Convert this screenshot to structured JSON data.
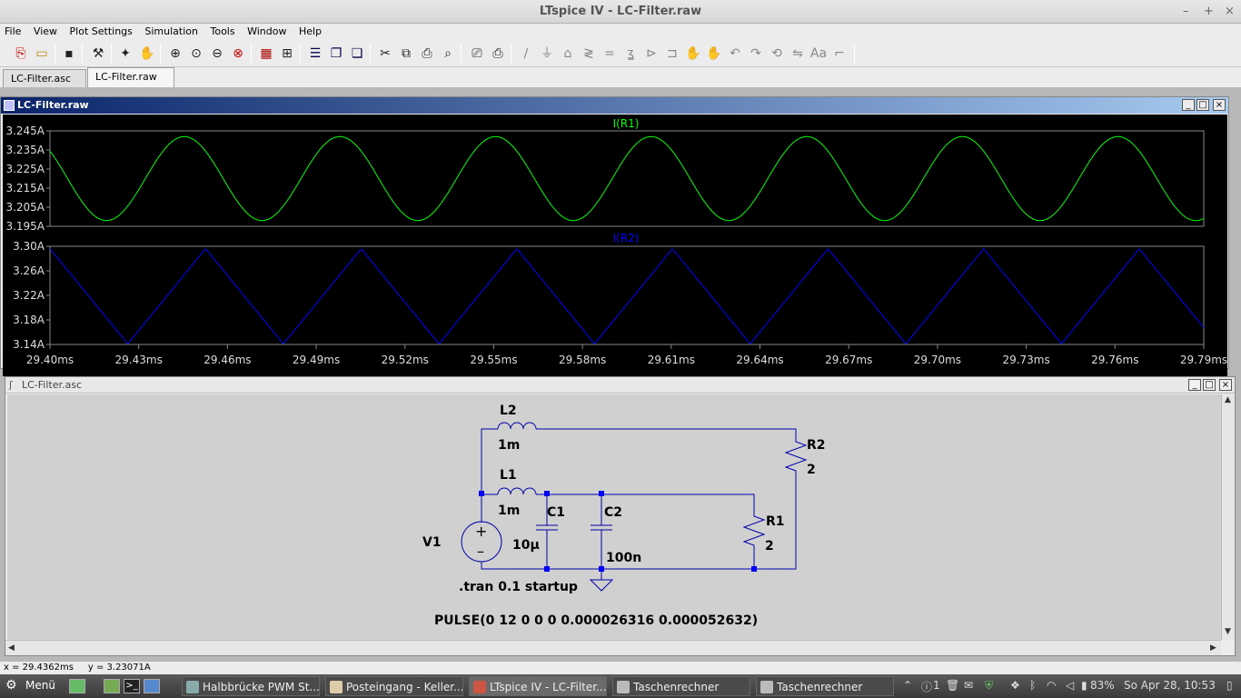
{
  "window": {
    "title": "LTspice IV - LC-Filter.raw",
    "min": "–",
    "max": "+",
    "close": "×"
  },
  "menu": [
    "File",
    "View",
    "Plot Settings",
    "Simulation",
    "Tools",
    "Window",
    "Help"
  ],
  "tabs": [
    {
      "label": "LC-Filter.asc",
      "active": false
    },
    {
      "label": "LC-Filter.raw",
      "active": true
    }
  ],
  "waveform_window": {
    "title": "LC-Filter.raw",
    "x_ticks": [
      "29.40ms",
      "29.43ms",
      "29.46ms",
      "29.49ms",
      "29.52ms",
      "29.55ms",
      "29.58ms",
      "29.61ms",
      "29.64ms",
      "29.67ms",
      "29.70ms",
      "29.73ms",
      "29.76ms",
      "29.79ms"
    ]
  },
  "chart_data": [
    {
      "type": "line",
      "series": [
        {
          "name": "I(R1)",
          "color": "#00ff00"
        }
      ],
      "xlim": [
        29.4,
        29.79
      ],
      "ylim": [
        3.195,
        3.245
      ],
      "y_ticks": [
        "3.245A",
        "3.235A",
        "3.225A",
        "3.215A",
        "3.205A",
        "3.195A"
      ],
      "period_ms": 0.0526,
      "y_min": 3.198,
      "y_max": 3.242
    },
    {
      "type": "line",
      "series": [
        {
          "name": "I(R2)",
          "color": "#0000ff"
        }
      ],
      "xlim": [
        29.4,
        29.79
      ],
      "ylim": [
        3.14,
        3.3
      ],
      "y_ticks": [
        "3.30A",
        "3.26A",
        "3.22A",
        "3.18A",
        "3.14A"
      ],
      "period_ms": 0.0526,
      "y_min": 3.141,
      "y_max": 3.296
    }
  ],
  "schematic_window": {
    "title": "LC-Filter.asc",
    "components": {
      "L2": {
        "name": "L2",
        "value": "1m"
      },
      "L1": {
        "name": "L1",
        "value": "1m"
      },
      "R2": {
        "name": "R2",
        "value": "2"
      },
      "R1": {
        "name": "R1",
        "value": "2"
      },
      "C1": {
        "name": "C1",
        "value": "10µ"
      },
      "C2": {
        "name": "C2",
        "value": "100n"
      },
      "V1": {
        "name": "V1"
      }
    },
    "directive": ".tran 0.1 startup",
    "source_value": "PULSE(0 12 0 0 0 0.000026316 0.000052632)"
  },
  "status": {
    "x": "x = 29.4362ms",
    "y": "y = 3.23071A"
  },
  "taskbar": {
    "menu_label": "Menü",
    "tasks": [
      {
        "label": "Halbbrücke PWM St...",
        "active": false
      },
      {
        "label": "Posteingang - Keller...",
        "active": false
      },
      {
        "label": "LTspice IV - LC-Filter....",
        "active": true
      },
      {
        "label": "Taschenrechner",
        "active": false
      },
      {
        "label": "Taschenrechner",
        "active": false
      }
    ],
    "battery": "83%",
    "clock": "So Apr 28, 10:53",
    "notify_count": "1"
  }
}
